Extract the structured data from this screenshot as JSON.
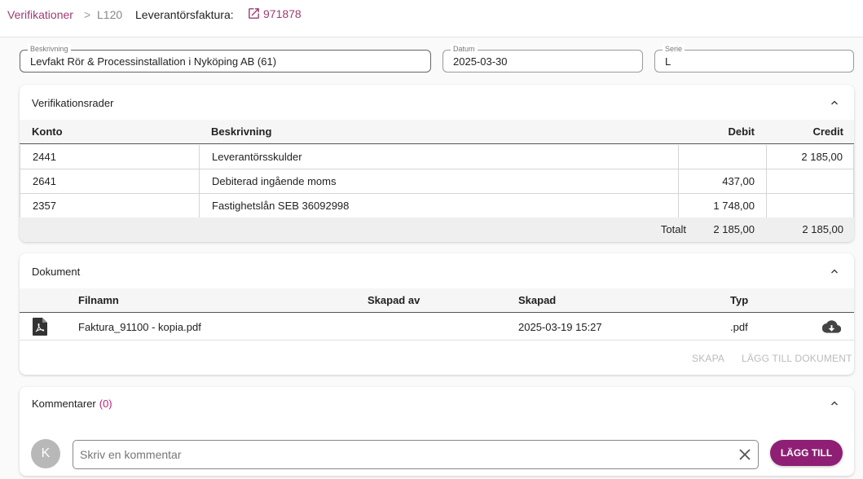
{
  "breadcrumb": {
    "root": "Verifikationer",
    "separator": ">",
    "current": "L120",
    "invoice_label": "Leverantörsfaktura:",
    "invoice_number": "971878"
  },
  "fields": {
    "description": {
      "label": "Beskrivning",
      "value": "Levfakt Rör & Processinstallation i Nyköping AB (61)"
    },
    "date": {
      "label": "Datum",
      "value": "2025-03-30"
    },
    "series": {
      "label": "Serie",
      "value": "L"
    }
  },
  "verification_rows": {
    "title": "Verifikationsrader",
    "headers": {
      "account": "Konto",
      "description": "Beskrivning",
      "debit": "Debit",
      "credit": "Credit"
    },
    "rows": [
      {
        "account": "2441",
        "description": "Leverantörsskulder",
        "debit": "",
        "credit": "2 185,00"
      },
      {
        "account": "2641",
        "description": "Debiterad ingående moms",
        "debit": "437,00",
        "credit": ""
      },
      {
        "account": "2357",
        "description": "Fastighetslån SEB 36092998",
        "debit": "1 748,00",
        "credit": ""
      }
    ],
    "total": {
      "label": "Totalt",
      "debit": "2 185,00",
      "credit": "2 185,00"
    }
  },
  "documents": {
    "title": "Dokument",
    "headers": {
      "filename": "Filnamn",
      "created_by": "Skapad av",
      "created": "Skapad",
      "type": "Typ"
    },
    "rows": [
      {
        "filename": "Faktura_91100 - kopia.pdf",
        "created_by": "",
        "created": "2025-03-19 15:27",
        "type": ".pdf"
      }
    ],
    "actions": {
      "create": "SKAPA",
      "add": "LÄGG TILL DOKUMENT"
    }
  },
  "comments": {
    "title": "Kommentarer",
    "count": "(0)",
    "avatar_initial": "K",
    "placeholder": "Skriv en kommentar",
    "add_label": "LÄGG TILL"
  },
  "colors": {
    "accent": "#9c3d72",
    "button": "#8e1f74",
    "count": "#c0217d"
  },
  "icons": [
    "external-link-icon",
    "chevron-up-icon",
    "pdf-file-icon",
    "cloud-download-icon",
    "clear-icon"
  ]
}
